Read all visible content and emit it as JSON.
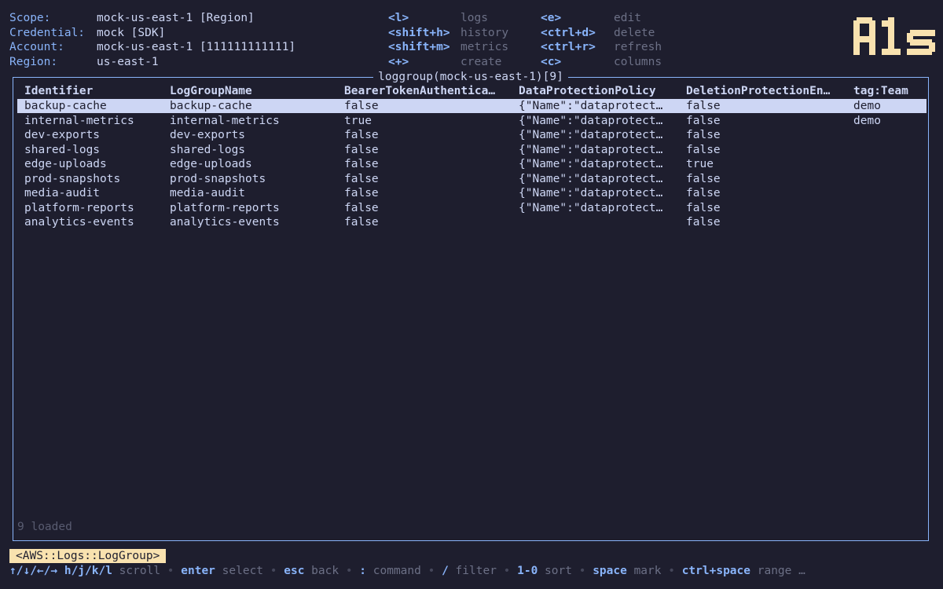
{
  "header": {
    "info": [
      {
        "label": "Scope:",
        "value": "mock-us-east-1 [Region]"
      },
      {
        "label": "Credential:",
        "value": "mock [SDK]"
      },
      {
        "label": "Account:",
        "value": "mock-us-east-1 [111111111111]"
      },
      {
        "label": "Region:",
        "value": "us-east-1"
      }
    ],
    "hints_col1": [
      {
        "key": "<l>",
        "action": "logs"
      },
      {
        "key": "<shift+h>",
        "action": "history"
      },
      {
        "key": "<shift+m>",
        "action": "metrics"
      },
      {
        "key": "<+>",
        "action": "create"
      }
    ],
    "hints_col2": [
      {
        "key": "<e>",
        "action": "edit"
      },
      {
        "key": "<ctrl+d>",
        "action": "delete"
      },
      {
        "key": "<ctrl+r>",
        "action": "refresh"
      },
      {
        "key": "<c>",
        "action": "columns"
      }
    ],
    "logo_color": "#f9e2af"
  },
  "table": {
    "title": "loggroup(mock-us-east-1)[9]",
    "columns": [
      "Identifier",
      "LogGroupName",
      "BearerTokenAuthentica…",
      "DataProtectionPolicy",
      "DeletionProtectionEn…",
      "tag:Team"
    ],
    "rows": [
      [
        "backup-cache",
        "backup-cache",
        "false",
        "{\"Name\":\"dataprotect…",
        "false",
        "demo"
      ],
      [
        "internal-metrics",
        "internal-metrics",
        "true",
        "{\"Name\":\"dataprotect…",
        "false",
        "demo"
      ],
      [
        "dev-exports",
        "dev-exports",
        "false",
        "{\"Name\":\"dataprotect…",
        "false",
        ""
      ],
      [
        "shared-logs",
        "shared-logs",
        "false",
        "{\"Name\":\"dataprotect…",
        "false",
        ""
      ],
      [
        "edge-uploads",
        "edge-uploads",
        "false",
        "{\"Name\":\"dataprotect…",
        "true",
        ""
      ],
      [
        "prod-snapshots",
        "prod-snapshots",
        "false",
        "{\"Name\":\"dataprotect…",
        "false",
        ""
      ],
      [
        "media-audit",
        "media-audit",
        "false",
        "{\"Name\":\"dataprotect…",
        "false",
        ""
      ],
      [
        "platform-reports",
        "platform-reports",
        "false",
        "{\"Name\":\"dataprotect…",
        "false",
        ""
      ],
      [
        "analytics-events",
        "analytics-events",
        "false",
        "",
        "false",
        ""
      ]
    ],
    "selected_row": 0,
    "status": "9 loaded"
  },
  "breadcrumb": "<AWS::Logs::LogGroup>",
  "footer": [
    {
      "key": "↑/↓/←/→ h/j/k/l",
      "action": "scroll"
    },
    {
      "key": "enter",
      "action": "select"
    },
    {
      "key": "esc",
      "action": "back"
    },
    {
      "key": ":",
      "action": "command"
    },
    {
      "key": "/",
      "action": "filter"
    },
    {
      "key": "1-0",
      "action": "sort"
    },
    {
      "key": "space",
      "action": "mark"
    },
    {
      "key": "ctrl+space",
      "action": "range"
    }
  ],
  "footer_ellipsis": "…",
  "colors": {
    "background": "#1e1e2e",
    "accent": "#89b4fa",
    "text": "#cdd6f4",
    "muted": "#6c7086",
    "highlight": "#f9e2af"
  }
}
